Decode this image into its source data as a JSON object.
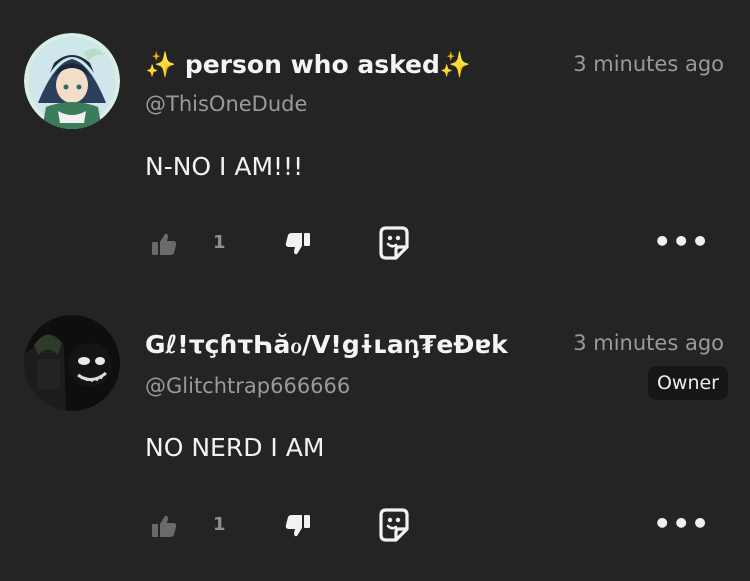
{
  "comments": [
    {
      "author": "✨ person who asked✨",
      "handle": "@ThisOneDude",
      "time": "3 minutes ago",
      "text": "N-NO I AM!!!",
      "likes": "1",
      "more": "•••"
    },
    {
      "author": "Gℓ!τçɦτҺăℴ/V!gɨʟаᶇ₮eĐɐk",
      "handle": "@Glitchtrap666666",
      "time": "3 minutes ago",
      "text": "NO NERD I AM",
      "badge": "Owner",
      "likes": "1",
      "more": "•••"
    }
  ],
  "colors": {
    "background": "#242424",
    "muted": "#9a9a9a",
    "badge_bg": "#161616",
    "avatar1_ring": "#d9efe3"
  },
  "icons": [
    "like-icon",
    "dislike-icon",
    "sticker-icon",
    "more-icon"
  ]
}
